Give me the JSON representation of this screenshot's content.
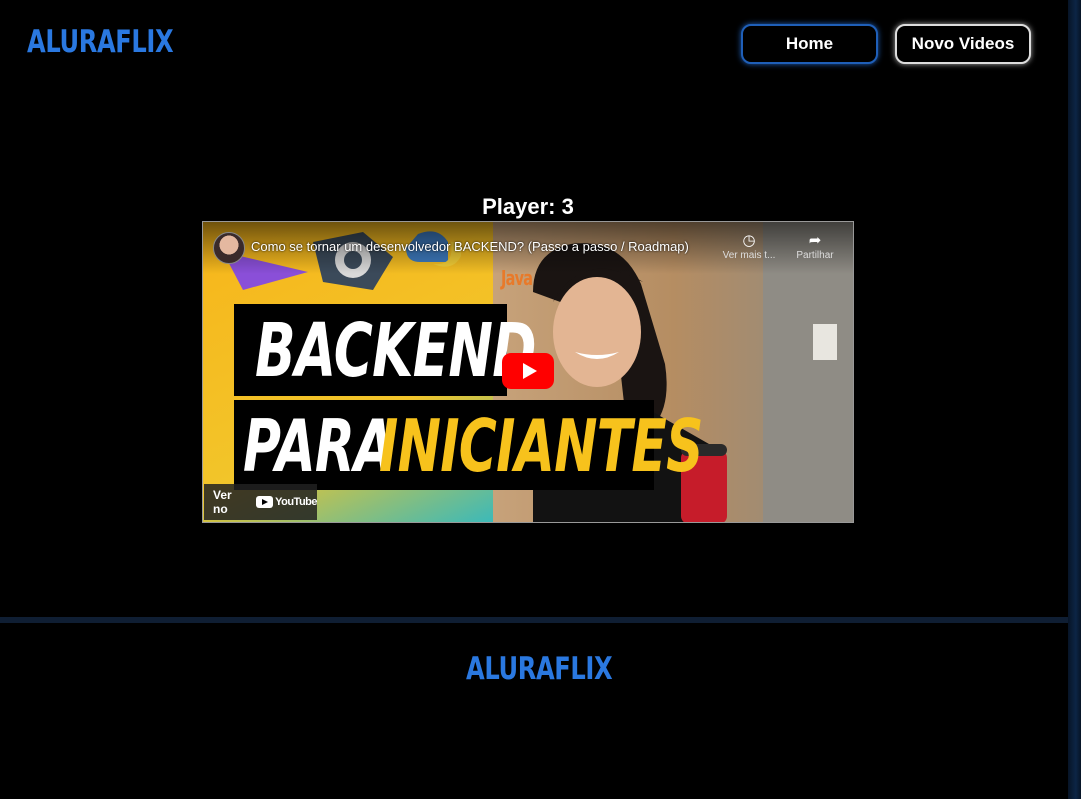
{
  "header": {
    "logo": "ALURAFLIX",
    "nav": {
      "home_label": "Home",
      "new_label": "Novo Videos"
    }
  },
  "main": {
    "player_title": "Player: 3",
    "video": {
      "title": "Como se tornar um desenvolvedor BACKEND? (Passo a passo / Roadmap)",
      "watch_later_label": "Ver mais t...",
      "share_label": "Partilhar",
      "thumbnail_line1": "BACKEND",
      "thumbnail_line2a": "PARA",
      "thumbnail_line2b": "INICIANTES",
      "thumbnail_badge": "Java",
      "watch_on_label": "Ver no",
      "youtube_label": "YouTube"
    }
  },
  "footer": {
    "logo": "ALURAFLIX"
  },
  "colors": {
    "brand": "#2a78e0",
    "accent_yellow": "#f7c21c",
    "play_red": "#ff0000"
  }
}
